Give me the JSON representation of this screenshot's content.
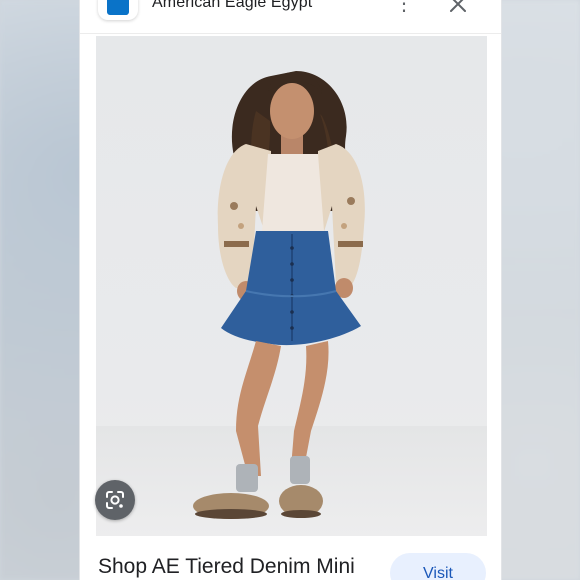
{
  "header": {
    "site_name": "American Eagle Egypt",
    "favicon_icon": "american-eagle-favicon",
    "more_icon": "more-vert-icon",
    "close_icon": "close-icon",
    "more_glyph": "⋮"
  },
  "image": {
    "lens_icon": "google-lens-icon"
  },
  "footer": {
    "title": "Shop AE Tiered Denim Mini",
    "visit_label": "Visit"
  },
  "colors": {
    "brand": "#0a73c8",
    "visit_bg": "#e8f0fe",
    "visit_text": "#1a57b8",
    "lens_bg": "#5f6368"
  }
}
